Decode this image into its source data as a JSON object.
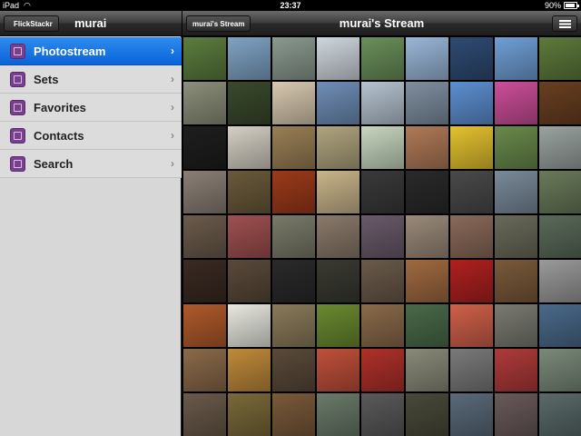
{
  "status": {
    "device": "iPad",
    "time": "23:37",
    "battery": "90%",
    "battery_level": 0.9
  },
  "left": {
    "back_label": "FlickStackr",
    "title": "murai",
    "menu": [
      {
        "label": "Photostream",
        "icon": "photostream-icon",
        "selected": true
      },
      {
        "label": "Sets",
        "icon": "sets-icon"
      },
      {
        "label": "Favorites",
        "icon": "favorites-icon"
      },
      {
        "label": "Contacts",
        "icon": "contacts-icon"
      },
      {
        "label": "Search",
        "icon": "search-icon"
      }
    ]
  },
  "right": {
    "button_label": "murai's Stream",
    "title": "murai's Stream",
    "list_icon": "list-view-icon"
  },
  "photo_colors": [
    "#5b7d3e",
    "#7fa3c4",
    "#8a9a8f",
    "#cfd7de",
    "#6a8f5a",
    "#9ab7d8",
    "#2f4b73",
    "#6f9fd6",
    "#5e7a3c",
    "#8c8f7a",
    "#3a4a2c",
    "#d8c9b0",
    "#6f8eb7",
    "#b6c3d1",
    "#7f8fa0",
    "#5d8fd1",
    "#cc4e99",
    "#6a3f21",
    "#1e1e1e",
    "#d5cfc3",
    "#9a7f55",
    "#b0a57f",
    "#c8d7c0",
    "#b07a58",
    "#e4c22f",
    "#6a8a4b",
    "#9aa3a0",
    "#8a7f75",
    "#6a5a3a",
    "#9c3a1a",
    "#c9b58a",
    "#3a3a3a",
    "#2a2a2a",
    "#4a4a4a",
    "#7a8a9a",
    "#6a7a5a",
    "#6b5b4b",
    "#a05050",
    "#7a7a6a",
    "#8a7a6a",
    "#6a5a6a",
    "#9a8a7a",
    "#8a6a5a",
    "#6a6a5a",
    "#5a6a5a",
    "#3a2a22",
    "#5a4a3a",
    "#2a2a2a",
    "#3a3a32",
    "#6a5a4a",
    "#a06a40",
    "#b02020",
    "#7a5a3a",
    "#9a9a9a",
    "#b05a2a",
    "#e8e8e0",
    "#8a7a5a",
    "#6a8a30",
    "#8a6a4a",
    "#4a6a4a",
    "#d0604a",
    "#7a7a72",
    "#4a6a8a",
    "#8a6a4a",
    "#c08a3a",
    "#5a4a3a",
    "#c0503a",
    "#b0302a",
    "#8a8a7a",
    "#7a7a7a",
    "#b03a3a",
    "#7a8a7a",
    "#6a5a4a",
    "#7a6a3a",
    "#7a5a3a",
    "#6a7a6a",
    "#5a5a5a",
    "#4a4a3a",
    "#5a6a7a",
    "#6a5a5a",
    "#5a6a6a"
  ]
}
